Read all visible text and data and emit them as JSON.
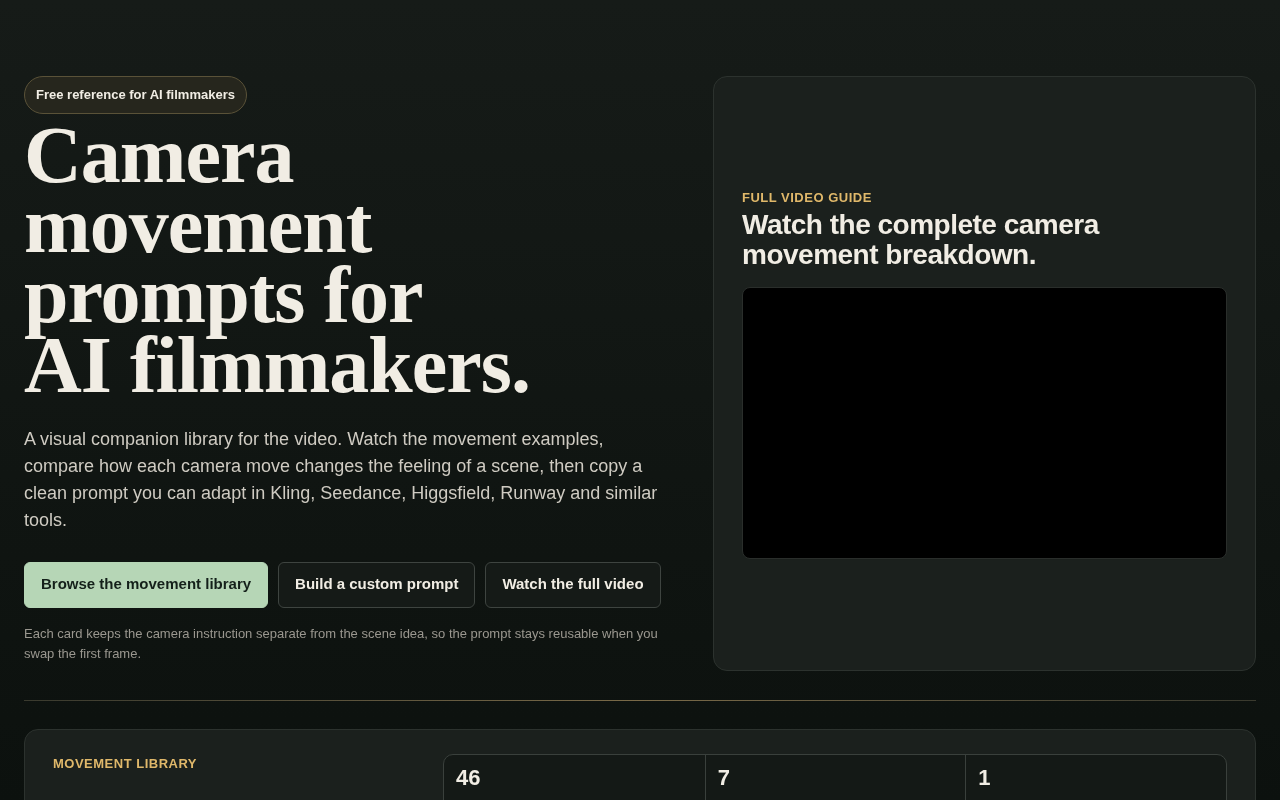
{
  "hero": {
    "badge": "Free reference for AI filmmakers",
    "title_lines": [
      "Camera",
      "movement",
      "prompts for",
      "AI filmmakers."
    ],
    "description": "A visual companion library for the video. Watch the movement examples, compare how each camera move changes the feeling of a scene, then copy a clean prompt you can adapt in Kling, Seedance, Higgsfield, Runway and similar tools.",
    "buttons": [
      {
        "label": "Browse the movement library",
        "kind": "primary"
      },
      {
        "label": "Build a custom prompt",
        "kind": "secondary"
      },
      {
        "label": "Watch the full video",
        "kind": "secondary"
      }
    ],
    "note": "Each card keeps the camera instruction separate from the scene idea, so the prompt stays reusable when you swap the first frame."
  },
  "video_card": {
    "eyebrow": "FULL VIDEO GUIDE",
    "title": "Watch the complete camera movement breakdown."
  },
  "library": {
    "eyebrow": "MOVEMENT LIBRARY",
    "stats": [
      "46",
      "7",
      "1"
    ]
  }
}
